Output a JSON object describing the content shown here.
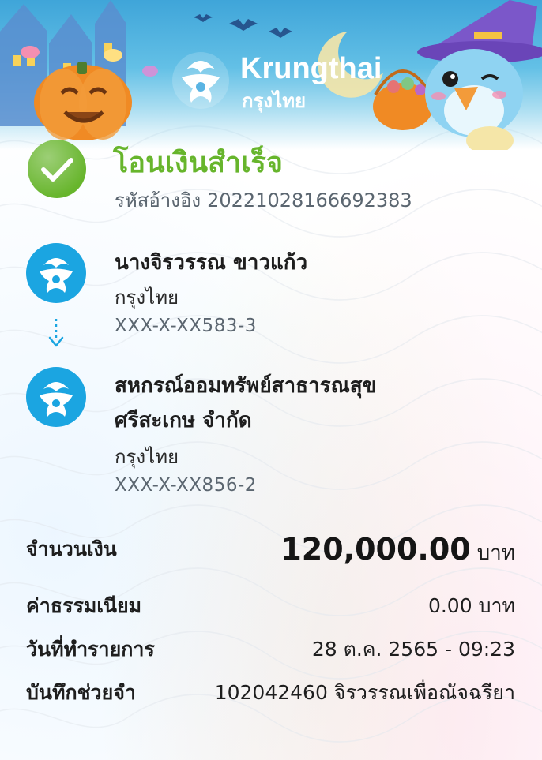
{
  "banner": {
    "brand_name": "Krungthai",
    "brand_name_th": "กรุงไทย",
    "logo_icon": "krungthai-phoenix-logo",
    "theme": "halloween",
    "colors": {
      "sky": "#3fa5d9",
      "pumpkin": "#f08a24",
      "mascot_blue": "#8fd3f2",
      "witch_hat": "#7b57c9"
    }
  },
  "status": {
    "icon": "check-circle-icon",
    "icon_color": "#67b52c",
    "title": "โอนเงินสำเร็จ",
    "title_color": "#67b52c",
    "ref_label": "รหัสอ้างอิง",
    "ref_value": "20221028166692383"
  },
  "sender": {
    "icon": "krungthai-bank-icon",
    "name": "นางจิรวรรณ ขาวแก้ว",
    "bank": "กรุงไทย",
    "account": "XXX-X-XX583-3"
  },
  "transfer_arrow_icon": "arrow-down-icon",
  "recipient": {
    "icon": "krungthai-bank-icon",
    "name_line1": "สหกรณ์ออมทรัพย์สาธารณสุข",
    "name_line2": "ศรีสะเกษ จำกัด",
    "bank": "กรุงไทย",
    "account": "XXX-X-XX856-2"
  },
  "details": {
    "amount_label": "จำนวนเงิน",
    "amount_value": "120,000.00",
    "amount_unit": "บาท",
    "fee_label": "ค่าธรรมเนียม",
    "fee_value": "0.00",
    "fee_unit": "บาท",
    "date_label": "วันที่ทำรายการ",
    "date_value": "28 ต.ค. 2565 - 09:23",
    "memo_label": "บันทึกช่วยจำ",
    "memo_value": "102042460 จิรวรรณเพื่อณัจฉรียา"
  },
  "colors": {
    "brand_blue": "#1ba5e1",
    "text": "#1e1e1e",
    "muted": "#5b6670"
  }
}
